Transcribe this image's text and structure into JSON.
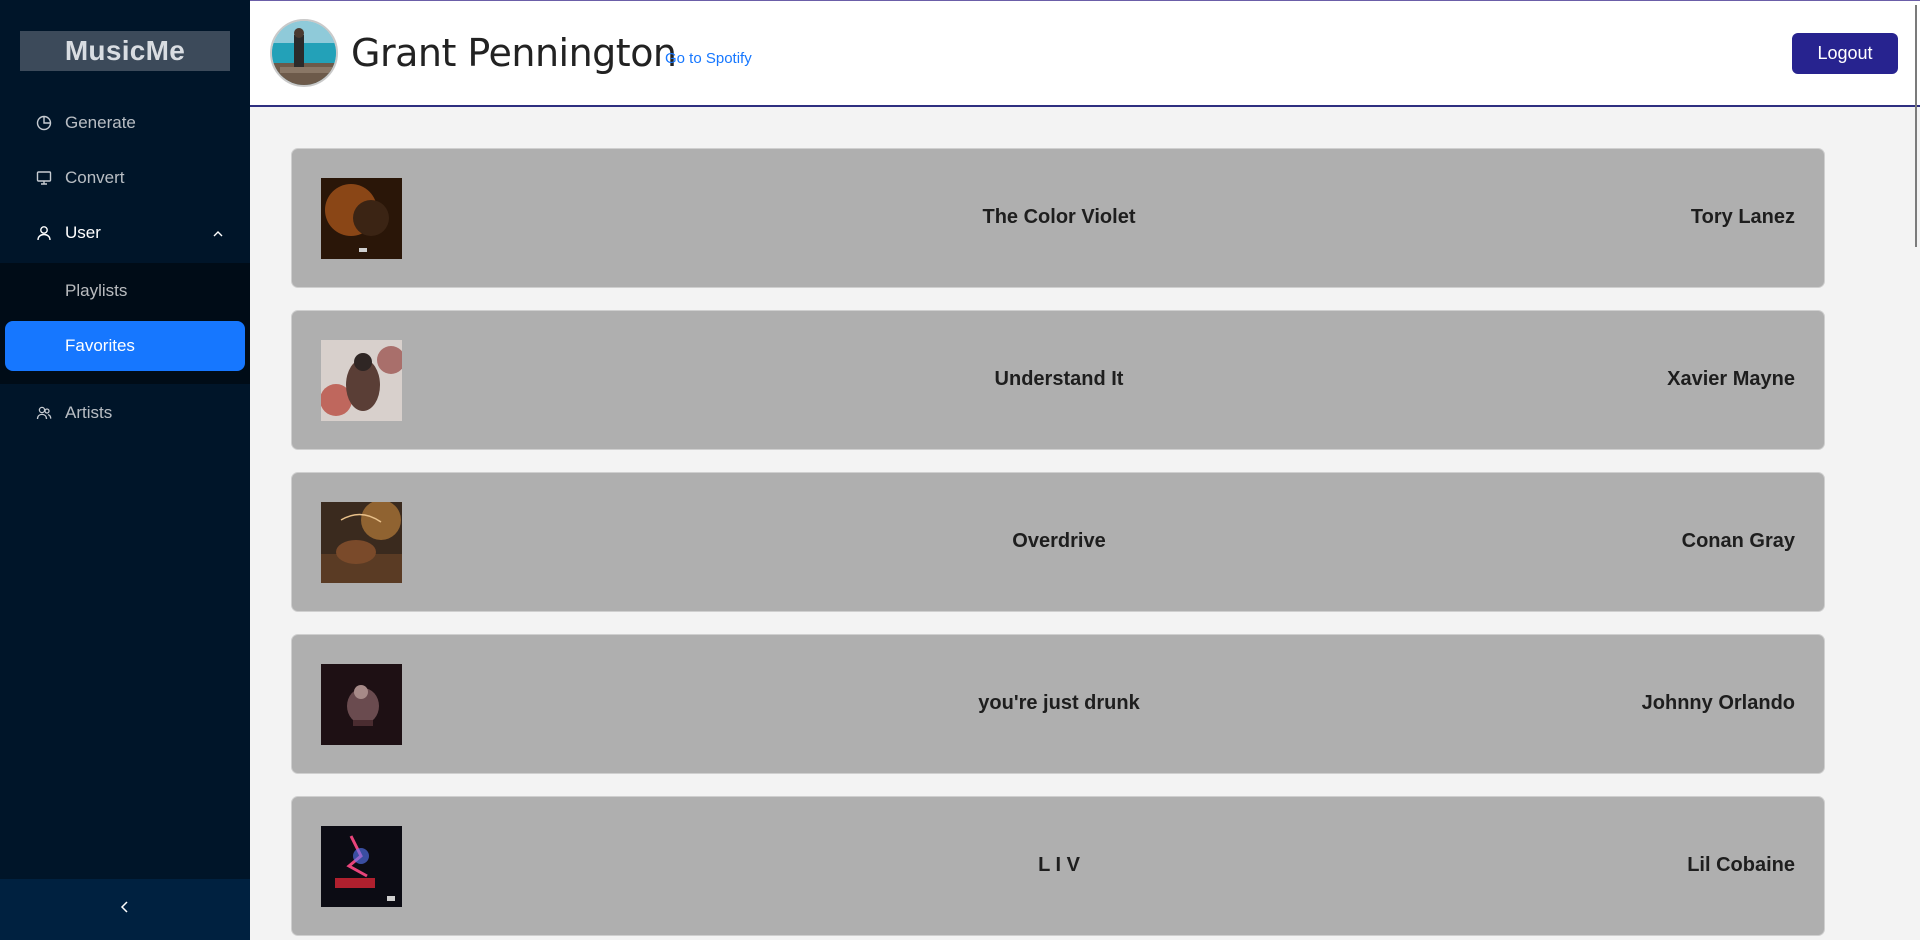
{
  "app": {
    "title": "MusicMe"
  },
  "sidebar": {
    "items": [
      {
        "label": "Generate",
        "icon": "pie-chart-icon"
      },
      {
        "label": "Convert",
        "icon": "desktop-icon"
      },
      {
        "label": "User",
        "icon": "user-icon",
        "expanded": true,
        "children": [
          {
            "label": "Playlists",
            "active": false
          },
          {
            "label": "Favorites",
            "active": true
          }
        ]
      },
      {
        "label": "Artists",
        "icon": "team-icon"
      }
    ],
    "collapse_icon": "chevron-left-icon"
  },
  "header": {
    "user_name": "Grant Pennington",
    "spotify_link": "Go to Spotify",
    "logout_label": "Logout"
  },
  "favorites": [
    {
      "title": "The Color Violet",
      "artist": "Tory Lanez"
    },
    {
      "title": "Understand It",
      "artist": "Xavier Mayne"
    },
    {
      "title": "Overdrive",
      "artist": "Conan Gray"
    },
    {
      "title": "you're just drunk",
      "artist": "Johnny Orlando"
    },
    {
      "title": "L I V",
      "artist": "Lil Cobaine"
    }
  ],
  "colors": {
    "sidebar_bg": "#001529",
    "active_item": "#1677ff",
    "logout_bg": "#27238f",
    "row_bg": "#afafaf"
  }
}
